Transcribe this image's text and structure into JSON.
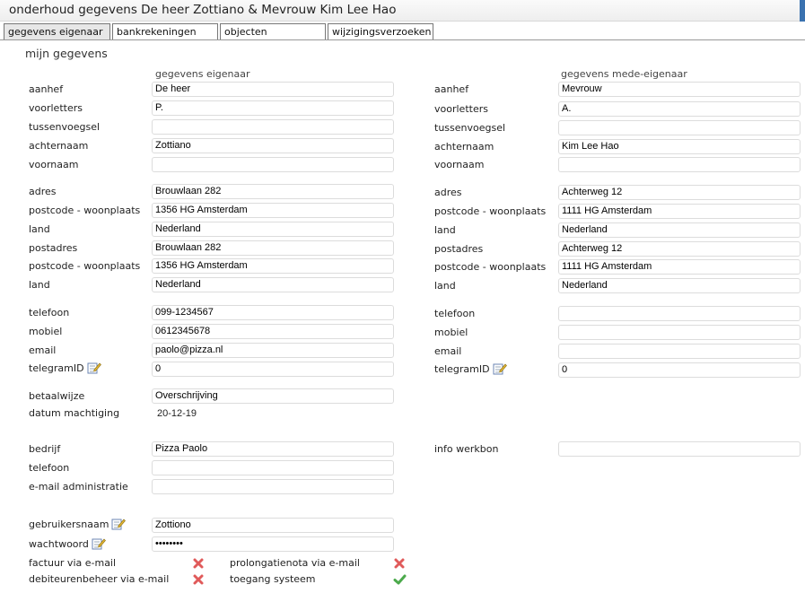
{
  "title": "onderhoud gegevens De heer Zottiano & Mevrouw Kim Lee Hao",
  "tabs": [
    "gegevens eigenaar",
    "bankrekeningen",
    "objecten",
    "wijzigingsverzoeken"
  ],
  "active_tab": 0,
  "section_title": "mijn gegevens",
  "owner_header": "gegevens eigenaar",
  "coowner_header": "gegevens mede-eigenaar",
  "owner": {
    "aanhef": {
      "label": "aanhef",
      "value": "De heer"
    },
    "voorletters": {
      "label": "voorletters",
      "value": "P."
    },
    "tussenvoegsel": {
      "label": "tussenvoegsel",
      "value": ""
    },
    "achternaam": {
      "label": "achternaam",
      "value": "Zottiano"
    },
    "voornaam": {
      "label": "voornaam",
      "value": ""
    },
    "adres": {
      "label": "adres",
      "value": "Brouwlaan 282"
    },
    "postcode": {
      "label": "postcode - woonplaats",
      "value": "1356 HG Amsterdam"
    },
    "land": {
      "label": "land",
      "value": "Nederland"
    },
    "postadres": {
      "label": "postadres",
      "value": "Brouwlaan 282"
    },
    "postcode2": {
      "label": "postcode - woonplaats",
      "value": "1356 HG Amsterdam"
    },
    "land2": {
      "label": "land",
      "value": "Nederland"
    },
    "telefoon": {
      "label": "telefoon",
      "value": "099-1234567"
    },
    "mobiel": {
      "label": "mobiel",
      "value": "0612345678"
    },
    "email": {
      "label": "email",
      "value": "paolo@pizza.nl"
    },
    "telegram": {
      "label": "telegramID",
      "value": "0"
    },
    "betaalwijze": {
      "label": "betaalwijze",
      "value": "Overschrijving"
    },
    "datum_machtiging": {
      "label": "datum machtiging",
      "value": "20-12-19"
    },
    "bedrijf": {
      "label": "bedrijf",
      "value": "Pizza Paolo"
    },
    "telefoon_bedrijf": {
      "label": "telefoon",
      "value": ""
    },
    "email_admin": {
      "label": "e-mail administratie",
      "value": ""
    },
    "gebruikersnaam": {
      "label": "gebruikersnaam",
      "value": "Zottiono"
    },
    "wachtwoord": {
      "label": "wachtwoord",
      "value": "••••••••"
    }
  },
  "coowner": {
    "aanhef": {
      "label": "aanhef",
      "value": "Mevrouw"
    },
    "voorletters": {
      "label": "voorletters",
      "value": "A."
    },
    "tussenvoegsel": {
      "label": "tussenvoegsel",
      "value": ""
    },
    "achternaam": {
      "label": "achternaam",
      "value": "Kim Lee Hao"
    },
    "voornaam": {
      "label": "voornaam",
      "value": ""
    },
    "adres": {
      "label": "adres",
      "value": "Achterweg 12"
    },
    "postcode": {
      "label": "postcode - woonplaats",
      "value": "1111 HG Amsterdam"
    },
    "land": {
      "label": "land",
      "value": "Nederland"
    },
    "postadres": {
      "label": "postadres",
      "value": "Achterweg 12"
    },
    "postcode2": {
      "label": "postcode - woonplaats",
      "value": "1111 HG Amsterdam"
    },
    "land2": {
      "label": "land",
      "value": "Nederland"
    },
    "telefoon": {
      "label": "telefoon",
      "value": ""
    },
    "mobiel": {
      "label": "mobiel",
      "value": ""
    },
    "email": {
      "label": "email",
      "value": ""
    },
    "telegram": {
      "label": "telegramID",
      "value": "0"
    },
    "info_werkbon": {
      "label": "info werkbon",
      "value": ""
    }
  },
  "preferences": {
    "factuur": {
      "label": "factuur via e-mail",
      "status": "no"
    },
    "debiteuren": {
      "label": "debiteurenbeheer via e-mail",
      "status": "no"
    },
    "prolongatie": {
      "label": "prolongatienota via e-mail",
      "status": "no"
    },
    "toegang": {
      "label": "toegang systeem",
      "status": "yes"
    }
  },
  "colors": {
    "no": "#e05a5a",
    "yes": "#4caa4c",
    "active_tab": "#e7e7e7",
    "accent": "#3a72b0"
  },
  "icons": {
    "edit": "edit-icon",
    "no": "cross-icon",
    "yes": "check-icon"
  }
}
